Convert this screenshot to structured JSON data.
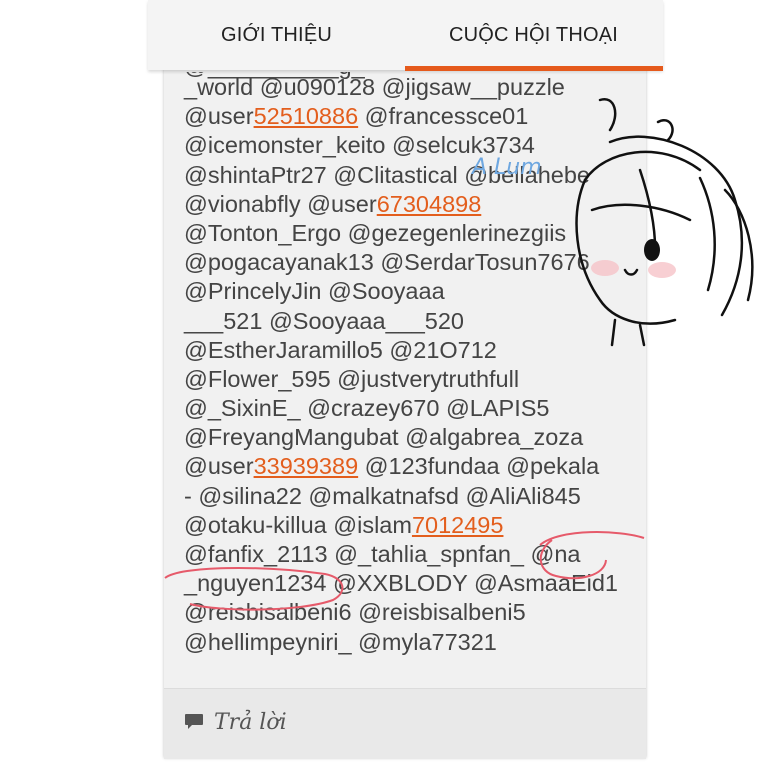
{
  "tabs": {
    "intro_label": "GIỚI THIỆU",
    "conversation_label": "CUỘC HỘI THOẠI"
  },
  "message": {
    "lines": [
      [
        {
          "t": "_world @u090128 @jigsaw__puzzle"
        }
      ],
      [
        {
          "t": "@user"
        },
        {
          "t": "52510886",
          "num": true
        },
        {
          "t": " @francessce01"
        }
      ],
      [
        {
          "t": "@icemonster_keito @selcuk3734"
        }
      ],
      [
        {
          "t": "@shintaPtr27 @Clitastical @bellahebe"
        }
      ],
      [
        {
          "t": "@vionabfly @user"
        },
        {
          "t": "67304898",
          "num": true
        }
      ],
      [
        {
          "t": "@Tonton_Ergo @gezegenlerinezgiis"
        }
      ],
      [
        {
          "t": "@pogacayanak13 @SerdarTosun7676"
        }
      ],
      [
        {
          "t": "@PrincelyJin @Sooyaaa"
        }
      ],
      [
        {
          "t": "___521 @Sooyaaa___520"
        }
      ],
      [
        {
          "t": "@EstherJaramillo5 @21O712"
        }
      ],
      [
        {
          "t": "@Flower_595 @justverytruthfull"
        }
      ],
      [
        {
          "t": "@_SixinE_ @crazey670 @LAPIS5"
        }
      ],
      [
        {
          "t": "@FreyangMangubat @algabrea_zoza"
        }
      ],
      [
        {
          "t": "@user"
        },
        {
          "t": "33939389",
          "num": true
        },
        {
          "t": " @123fundaa @pekala"
        }
      ],
      [
        {
          "t": "- @silina22 @malkatnafsd @AliAli845"
        }
      ],
      [
        {
          "t": "@otaku-killua @islam"
        },
        {
          "t": "7012495",
          "num": true
        }
      ],
      [
        {
          "t": "@fanfix_2113 @_tahlia_spnfan_ @na"
        }
      ],
      [
        {
          "t": "_nguyen1234 @XXBLODY @AsmaaEid1"
        }
      ],
      [
        {
          "t": "@reisbisalbeni6 @reisbisalbeni5"
        }
      ],
      [
        {
          "t": "@hellimpeyniri_ @myla77321"
        }
      ]
    ]
  },
  "reply": {
    "label": "Trả lời",
    "icon": "speech-bubble-icon"
  },
  "doodle": {
    "text": "A Lum"
  },
  "colors": {
    "accent": "#e55a1c",
    "link_number": "#e35e1d",
    "text": "#444444",
    "doodle_annotation": "#e65a6a",
    "doodle_text": "#6ea7e0"
  }
}
